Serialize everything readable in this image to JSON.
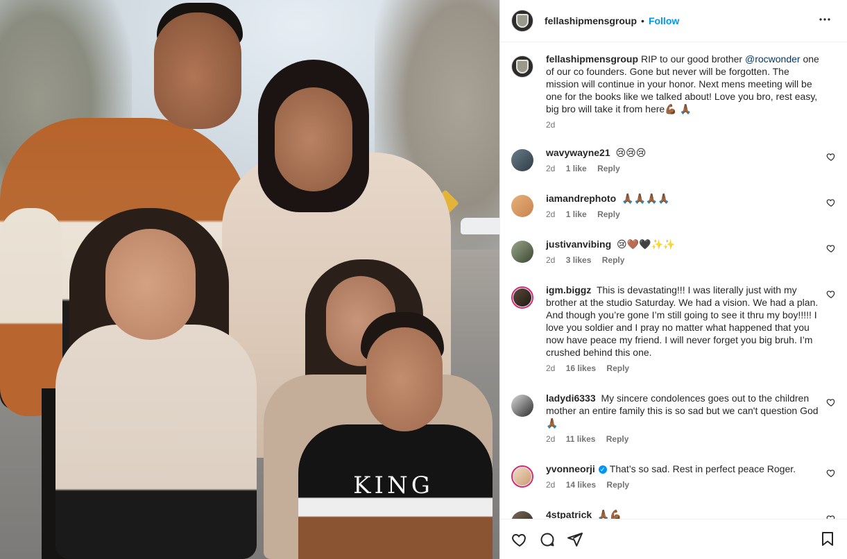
{
  "post": {
    "account": "fellashipmensgroup",
    "separator": "•",
    "follow_label": "Follow",
    "more_label": "•••",
    "caption_user": "fellashipmensgroup",
    "caption_before_mention": "RIP to our good brother ",
    "caption_mention": "@rocwonder",
    "caption_after_mention": " one of our co founders. Gone but never will be forgotten. The mission will continue in your honor. Next mens meeting will be one for the books like we talked about! Love you bro, rest easy, big bro will take it from here💪🏾 🙏🏾",
    "caption_time": "2d",
    "photo_shirt_text": "KING"
  },
  "comments": [
    {
      "user": "wavywayne21",
      "text": "😢😢😢",
      "time": "2d",
      "likes": "1 like",
      "reply": "Reply",
      "verified": false
    },
    {
      "user": "iamandrephoto",
      "text": "🙏🏾🙏🏾🙏🏾🙏🏾",
      "time": "2d",
      "likes": "1 like",
      "reply": "Reply",
      "verified": false
    },
    {
      "user": "justivanvibing",
      "text": "😢🤎🖤✨✨",
      "time": "2d",
      "likes": "3 likes",
      "reply": "Reply",
      "verified": false
    },
    {
      "user": "igm.biggz",
      "text": "This is devastating!!! I was literally just with my brother at the studio Saturday. We had a vision. We had a plan. And though you’re gone I’m still going to see it thru my boy!!!!! I love you soldier and I pray no matter what happened that you now have peace my friend. I will never forget you big bruh. I’m crushed behind this one.",
      "time": "2d",
      "likes": "16 likes",
      "reply": "Reply",
      "verified": false
    },
    {
      "user": "ladydi6333",
      "text": "My sincere condolences goes out to the children mother an entire family this is so sad but we can't question God 🙏🏾",
      "time": "2d",
      "likes": "11 likes",
      "reply": "Reply",
      "verified": false
    },
    {
      "user": "yvonneorji",
      "text": "That’s so sad. Rest in perfect peace Roger.",
      "time": "2d",
      "likes": "14 likes",
      "reply": "Reply",
      "verified": true
    },
    {
      "user": "4stpatrick",
      "text": "🙏🏾💪🏾",
      "time": "",
      "likes": "",
      "reply": "",
      "verified": false
    }
  ],
  "icons": {
    "more": "more-horizontal-icon",
    "like": "heart-icon",
    "comment": "comment-bubble-icon",
    "share": "paper-plane-icon",
    "save": "bookmark-icon",
    "verified": "verified-badge-icon"
  },
  "colors": {
    "accent": "#0095f6",
    "text": "#262626",
    "muted": "#737373",
    "mention": "#00376b",
    "divider": "#efefef"
  }
}
